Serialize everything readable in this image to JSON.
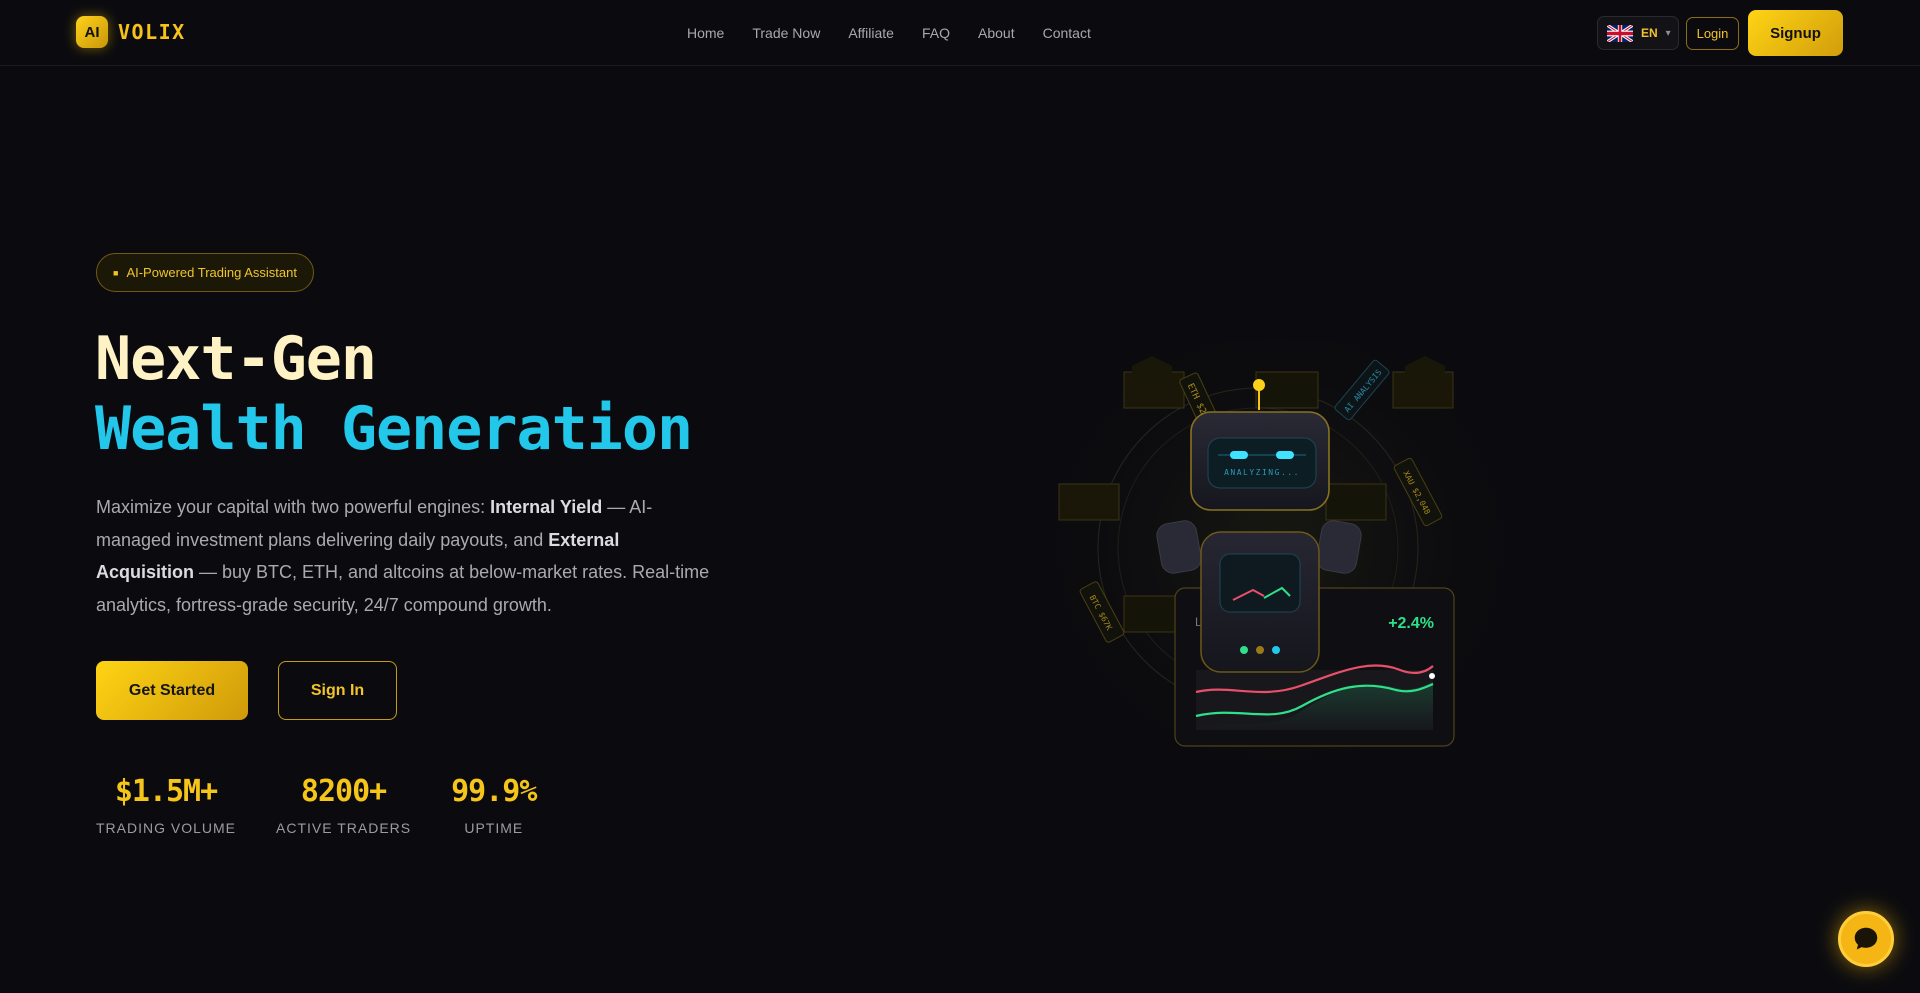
{
  "brand": {
    "badge": "AI",
    "name": "VOLIX"
  },
  "nav": {
    "items": [
      {
        "label": "Home"
      },
      {
        "label": "Trade Now"
      },
      {
        "label": "Affiliate"
      },
      {
        "label": "FAQ"
      },
      {
        "label": "About"
      },
      {
        "label": "Contact"
      }
    ]
  },
  "language": {
    "code": "EN",
    "flag_icon": "uk-flag-icon"
  },
  "auth": {
    "login": "Login",
    "signup": "Signup"
  },
  "hero": {
    "badge": "AI-Powered Trading Assistant",
    "title_line1": "Next-Gen",
    "title_line2": "Wealth Generation",
    "desc_part1": "Maximize your capital with two powerful engines: ",
    "desc_bold1": "Internal Yield",
    "desc_part2": " — AI-managed investment plans delivering daily payouts, and ",
    "desc_bold2": "External Acquisition",
    "desc_part3": " — buy BTC, ETH, and altcoins at below-market rates. Real-time analytics, fortress-grade security, 24/7 compound growth.",
    "cta_primary": "Get Started",
    "cta_secondary": "Sign In"
  },
  "stats": [
    {
      "value": "$1.5M+",
      "label": "TRADING VOLUME"
    },
    {
      "value": "8200+",
      "label": "ACTIVE TRADERS"
    },
    {
      "value": "99.9%",
      "label": "UPTIME"
    }
  ],
  "illustration": {
    "robot_status": "ANALYZING...",
    "chart_change": "+2.4%",
    "chart_label_partial": "L",
    "orbit_tags": [
      "ETH $2",
      "AI ANALYSIS",
      "XAU $2,048",
      "BTC $67K"
    ]
  },
  "colors": {
    "background": "#0b0b0f",
    "accent_gold": "#f6c519",
    "accent_cyan": "#22c7ea",
    "positive": "#2ee08a",
    "negative": "#e8506a"
  },
  "chat": {
    "icon": "chat-bubble-icon"
  }
}
